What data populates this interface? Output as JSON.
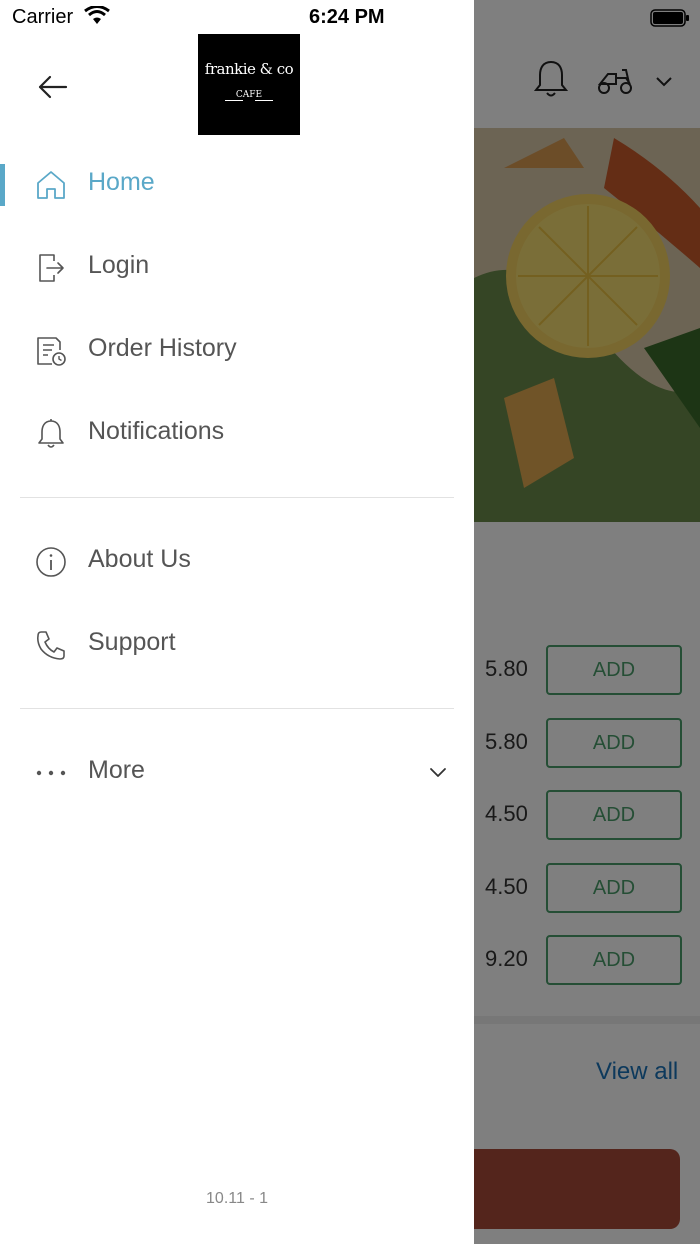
{
  "status_bar": {
    "carrier": "Carrier",
    "time": "6:24 PM"
  },
  "drawer": {
    "logo": {
      "text": "frankie & co",
      "subtext": "CAFE"
    },
    "items_primary": [
      {
        "label": "Home",
        "icon": "home-icon",
        "active": true
      },
      {
        "label": "Login",
        "icon": "login-icon",
        "active": false
      },
      {
        "label": "Order History",
        "icon": "order-history-icon",
        "active": false
      },
      {
        "label": "Notifications",
        "icon": "bell-icon",
        "active": false
      }
    ],
    "items_secondary": [
      {
        "label": "About Us",
        "icon": "info-icon"
      },
      {
        "label": "Support",
        "icon": "phone-icon"
      }
    ],
    "more": {
      "label": "More",
      "icon": "more-dots-icon"
    },
    "version": "10.11 - 1",
    "accent_color": "#5aa8c8"
  },
  "background_app": {
    "header_icons": [
      "bell-icon",
      "scooter-icon",
      "chevron-down-icon"
    ],
    "menu_items": [
      {
        "price": "5.80",
        "button": "ADD"
      },
      {
        "price": "5.80",
        "button": "ADD"
      },
      {
        "price": "4.50",
        "button": "ADD"
      },
      {
        "price": "4.50",
        "button": "ADD"
      },
      {
        "price": "9.20",
        "button": "ADD"
      }
    ],
    "view_all": "View all",
    "colors": {
      "add_button": "#4a9d6a",
      "view_all": "#1a73b8",
      "cart_bar": "#a84a38"
    }
  }
}
